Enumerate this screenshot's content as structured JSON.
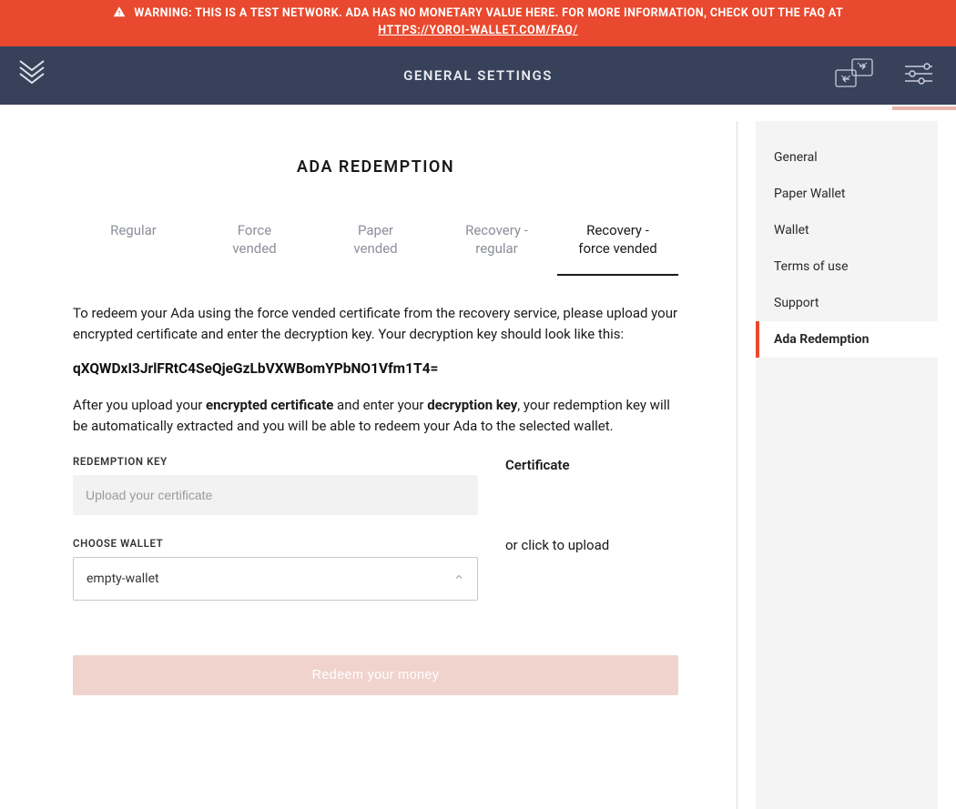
{
  "warning": {
    "line1": "WARNING: THIS IS A TEST NETWORK. ADA HAS NO MONETARY VALUE HERE. FOR MORE INFORMATION, CHECK OUT THE FAQ AT",
    "faq_link_text": "HTTPS://YOROI-WALLET.COM/FAQ/"
  },
  "header": {
    "title": "GENERAL SETTINGS"
  },
  "sidebar": {
    "items": [
      {
        "label": "General",
        "active": false
      },
      {
        "label": "Paper Wallet",
        "active": false
      },
      {
        "label": "Wallet",
        "active": false
      },
      {
        "label": "Terms of use",
        "active": false
      },
      {
        "label": "Support",
        "active": false
      },
      {
        "label": "Ada Redemption",
        "active": true
      }
    ]
  },
  "main": {
    "heading": "ADA REDEMPTION",
    "tabs": [
      {
        "label": "Regular",
        "active": false
      },
      {
        "label": "Force\nvended",
        "active": false
      },
      {
        "label": "Paper\nvended",
        "active": false
      },
      {
        "label": "Recovery -\nregular",
        "active": false
      },
      {
        "label": "Recovery -\nforce vended",
        "active": true
      }
    ],
    "intro_text": "To redeem your Ada using the force vended certificate from the recovery service, please upload your encrypted certificate and enter the decryption key. Your decryption key should look like this:",
    "key_example": "qXQWDxI3JrlFRtC4SeQjeGzLbVXWBomYPbNO1Vfm1T4=",
    "after_upload_pre": "After you upload your ",
    "bold1": "encrypted certificate",
    "after_upload_mid": " and enter your ",
    "bold2": "decryption key",
    "after_upload_post": ", your redemption key will be automatically extracted and you will be able to redeem your Ada to the selected wallet.",
    "form": {
      "redemption_key_label": "REDEMPTION KEY",
      "redemption_key_placeholder": "Upload your certificate",
      "choose_wallet_label": "CHOOSE WALLET",
      "wallet_selected": "empty-wallet",
      "certificate_label": "Certificate",
      "upload_hint": "or click to upload",
      "submit_label": "Redeem your money"
    }
  },
  "colors": {
    "warning_bg": "#E9492E",
    "header_bg": "#37415A",
    "accent_disabled": "#F0D3CD"
  }
}
